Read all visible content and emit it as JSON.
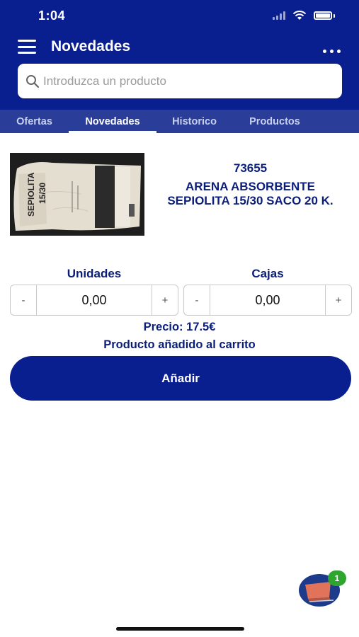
{
  "status_bar": {
    "time": "1:04"
  },
  "header": {
    "title": "Novedades"
  },
  "search": {
    "placeholder": "Introduzca un producto",
    "value": ""
  },
  "tabs": [
    {
      "label": "Ofertas",
      "active": false
    },
    {
      "label": "Novedades",
      "active": true
    },
    {
      "label": "Historico",
      "active": false
    },
    {
      "label": "Productos",
      "active": false
    }
  ],
  "product": {
    "code": "73655",
    "name_line1": "ARENA ABSORBENTE",
    "name_line2": "SEPIOLITA 15/30 SACO 20 K.",
    "image_text": "SEPIOLITA 15/30"
  },
  "quantity": {
    "units_label": "Unidades",
    "units_value": "0,00",
    "boxes_label": "Cajas",
    "boxes_value": "0,00",
    "minus": "-",
    "plus": "+"
  },
  "price_text": "Precio: 17.5€",
  "status_message": "Producto añadido al carrito",
  "add_button_label": "Añadir",
  "cart": {
    "count": "1"
  },
  "colors": {
    "primary": "#0a1f8f",
    "tab_bar": "#2a3d98",
    "text_primary": "#0b1e7a",
    "badge": "#2ea52e"
  },
  "icons": [
    "menu-icon",
    "more-icon",
    "search-icon",
    "cart-icon"
  ]
}
